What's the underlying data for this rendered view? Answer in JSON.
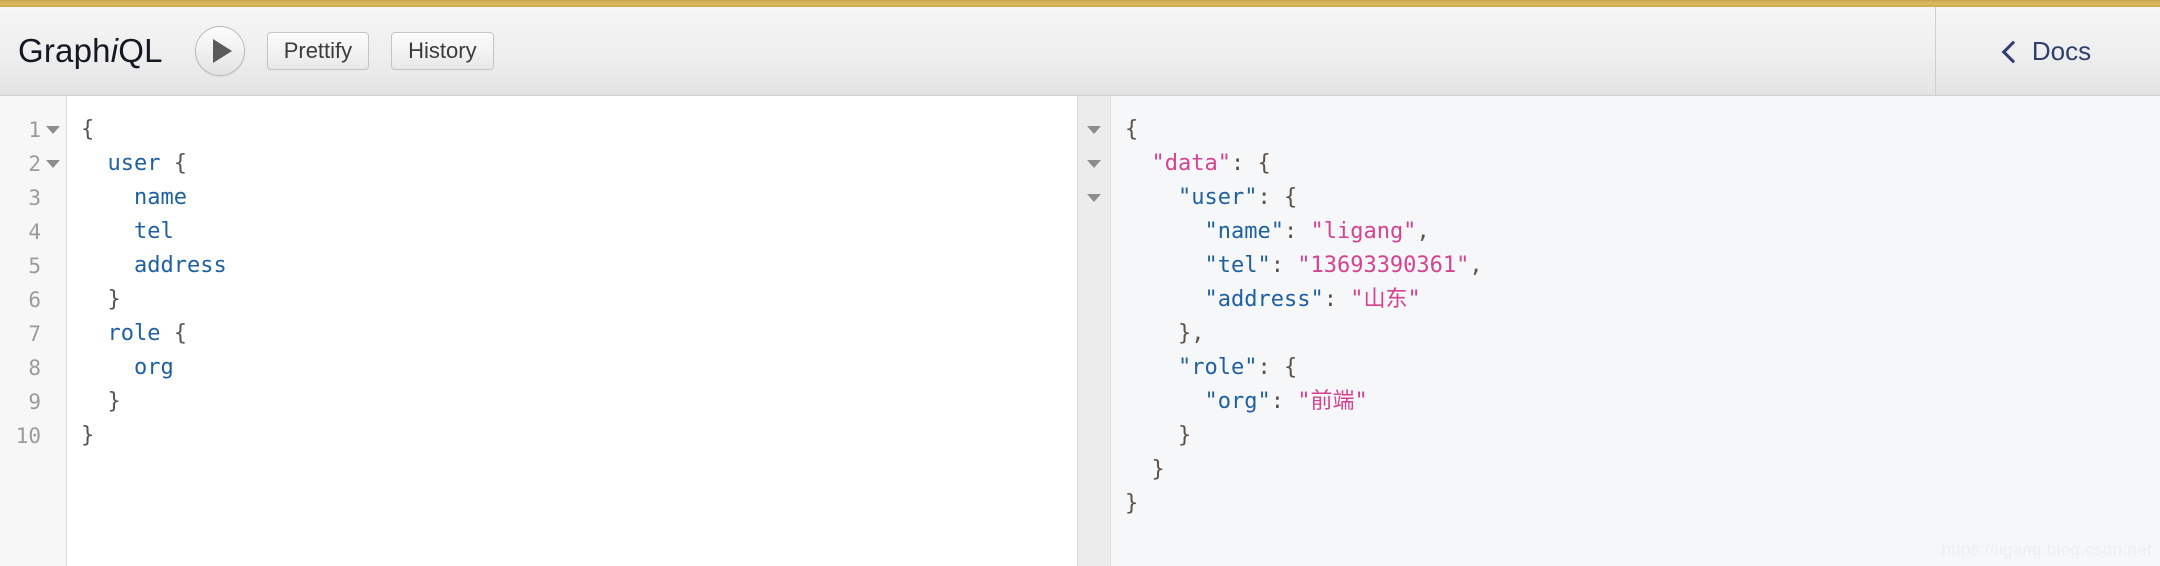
{
  "app": {
    "title_main": "Graph",
    "title_italic": "i",
    "title_end": "QL"
  },
  "toolbar": {
    "execute_label": "",
    "prettify_label": "Prettify",
    "history_label": "History",
    "docs_label": "Docs",
    "accent_stripe_color": "#cfa94f"
  },
  "query_editor": {
    "line_numbers": [
      "1",
      "2",
      "3",
      "4",
      "5",
      "6",
      "7",
      "8",
      "9",
      "10"
    ],
    "foldable_lines": [
      1,
      2
    ],
    "lines": [
      {
        "indent": 0,
        "tokens": [
          {
            "t": "{",
            "c": "punct"
          }
        ]
      },
      {
        "indent": 1,
        "tokens": [
          {
            "t": "user",
            "c": "field"
          },
          {
            "t": " {",
            "c": "punct"
          }
        ]
      },
      {
        "indent": 2,
        "tokens": [
          {
            "t": "name",
            "c": "field"
          }
        ]
      },
      {
        "indent": 2,
        "tokens": [
          {
            "t": "tel",
            "c": "field"
          }
        ]
      },
      {
        "indent": 2,
        "tokens": [
          {
            "t": "address",
            "c": "field"
          }
        ]
      },
      {
        "indent": 1,
        "tokens": [
          {
            "t": "}",
            "c": "punct"
          }
        ]
      },
      {
        "indent": 1,
        "tokens": [
          {
            "t": "role",
            "c": "field"
          },
          {
            "t": " {",
            "c": "punct"
          }
        ]
      },
      {
        "indent": 2,
        "tokens": [
          {
            "t": "org",
            "c": "field"
          }
        ]
      },
      {
        "indent": 1,
        "tokens": [
          {
            "t": "}",
            "c": "punct"
          }
        ]
      },
      {
        "indent": 0,
        "tokens": [
          {
            "t": "}",
            "c": "punct"
          }
        ]
      }
    ],
    "raw_text": "{\n  user {\n    name\n    tel\n    address\n  }\n  role {\n    org\n  }\n}"
  },
  "result_viewer": {
    "fold_arrow_count": 3,
    "lines": [
      {
        "indent": 0,
        "tokens": [
          {
            "t": "{",
            "c": "punct"
          }
        ]
      },
      {
        "indent": 1,
        "tokens": [
          {
            "t": "\"data\"",
            "c": "key-top"
          },
          {
            "t": ": {",
            "c": "punct"
          }
        ]
      },
      {
        "indent": 2,
        "tokens": [
          {
            "t": "\"user\"",
            "c": "key"
          },
          {
            "t": ": {",
            "c": "punct"
          }
        ]
      },
      {
        "indent": 3,
        "tokens": [
          {
            "t": "\"name\"",
            "c": "key"
          },
          {
            "t": ": ",
            "c": "punct"
          },
          {
            "t": "\"ligang\"",
            "c": "string"
          },
          {
            "t": ",",
            "c": "punct"
          }
        ]
      },
      {
        "indent": 3,
        "tokens": [
          {
            "t": "\"tel\"",
            "c": "key"
          },
          {
            "t": ": ",
            "c": "punct"
          },
          {
            "t": "\"13693390361\"",
            "c": "string"
          },
          {
            "t": ",",
            "c": "punct"
          }
        ]
      },
      {
        "indent": 3,
        "tokens": [
          {
            "t": "\"address\"",
            "c": "key"
          },
          {
            "t": ": ",
            "c": "punct"
          },
          {
            "t": "\"山东\"",
            "c": "string"
          }
        ]
      },
      {
        "indent": 2,
        "tokens": [
          {
            "t": "},",
            "c": "punct"
          }
        ]
      },
      {
        "indent": 2,
        "tokens": [
          {
            "t": "\"role\"",
            "c": "key"
          },
          {
            "t": ": {",
            "c": "punct"
          }
        ]
      },
      {
        "indent": 3,
        "tokens": [
          {
            "t": "\"org\"",
            "c": "key"
          },
          {
            "t": ": ",
            "c": "punct"
          },
          {
            "t": "\"前端\"",
            "c": "string"
          }
        ]
      },
      {
        "indent": 2,
        "tokens": [
          {
            "t": "}",
            "c": "punct"
          }
        ]
      },
      {
        "indent": 1,
        "tokens": [
          {
            "t": "}",
            "c": "punct"
          }
        ]
      },
      {
        "indent": 0,
        "tokens": [
          {
            "t": "}",
            "c": "punct"
          }
        ]
      }
    ],
    "response": {
      "data": {
        "user": {
          "name": "ligang",
          "tel": "13693390361",
          "address": "山东"
        },
        "role": {
          "org": "前端"
        }
      }
    }
  },
  "watermark": {
    "text": "https://ligang.blog.csdn.net"
  }
}
